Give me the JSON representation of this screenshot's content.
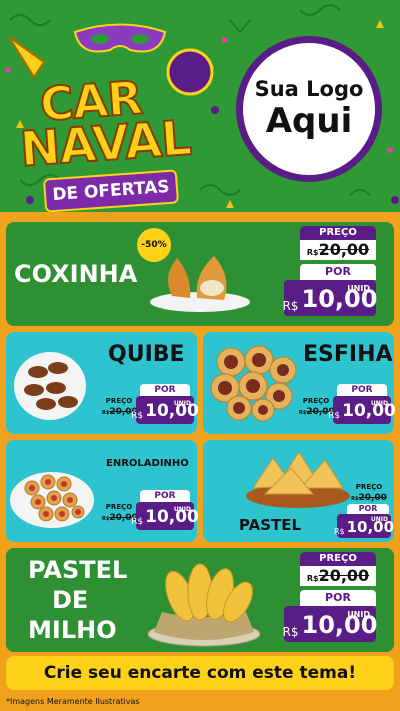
{
  "header": {
    "title_line1": "CAR",
    "title_line2": "NAVAL",
    "ribbon": "DE OFERTAS",
    "logo_line1": "Sua Logo",
    "logo_line2": "Aqui"
  },
  "products": [
    {
      "name": "COXINHA",
      "preco_label": "PREÇO",
      "old_currency": "R$",
      "old_value": "20,00",
      "por_label": "POR",
      "currency": "R$",
      "value": "10,00",
      "unit": "UNID",
      "badge": "-50%"
    },
    {
      "name": "QUIBE",
      "preco_label": "PREÇO",
      "old_currency": "R$",
      "old_value": "20,00",
      "por_label": "POR",
      "currency": "R$",
      "value": "10,00",
      "unit": "UNID"
    },
    {
      "name": "ESFIHA",
      "preco_label": "PREÇO",
      "old_currency": "R$",
      "old_value": "20,00",
      "por_label": "POR",
      "currency": "R$",
      "value": "10,00",
      "unit": "UNID"
    },
    {
      "name": "ENROLADINHO",
      "preco_label": "PREÇO",
      "old_currency": "R$",
      "old_value": "20,00",
      "por_label": "POR",
      "currency": "R$",
      "value": "10,00",
      "unit": "UNID"
    },
    {
      "name": "PASTEL",
      "preco_label": "PREÇO",
      "old_currency": "R$",
      "old_value": "20,00",
      "por_label": "POR",
      "currency": "R$",
      "value": "10,00",
      "unit": "UNID"
    },
    {
      "name_line1": "PASTEL",
      "name_line2": "DE",
      "name_line3": "MILHO",
      "preco_label": "PREÇO",
      "old_currency": "R$",
      "old_value": "20,00",
      "por_label": "POR",
      "currency": "R$",
      "value": "10,00",
      "unit": "UNID"
    }
  ],
  "banner": "Crie seu encarte com este tema!",
  "footnote": "*Imagens Meramente Ilustrativas",
  "colors": {
    "green": "#2e8f33",
    "cyan": "#2ec4cf",
    "purple": "#5a1c86",
    "yellow": "#ffd21a",
    "orange": "#f0a21c"
  }
}
